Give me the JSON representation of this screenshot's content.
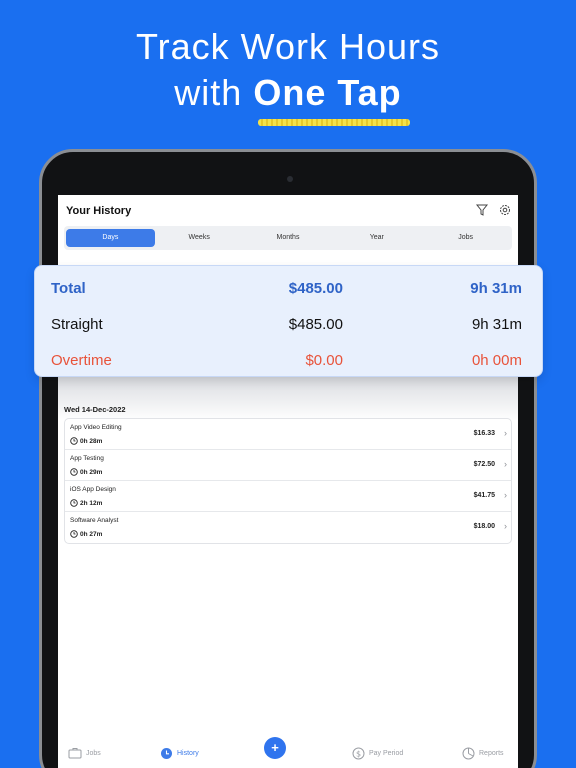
{
  "headline": {
    "line1": "Track Work Hours",
    "line2_prefix": "with ",
    "line2_bold": "One Tap"
  },
  "header": {
    "title": "Your History",
    "icons": [
      "filter-icon",
      "gear-icon"
    ]
  },
  "tabs": [
    {
      "label": "Days",
      "active": true
    },
    {
      "label": "Weeks",
      "active": false
    },
    {
      "label": "Months",
      "active": false
    },
    {
      "label": "Year",
      "active": false
    },
    {
      "label": "Jobs",
      "active": false
    }
  ],
  "summary": {
    "total": {
      "label": "Total",
      "amount": "$485.00",
      "time": "9h 31m"
    },
    "straight": {
      "label": "Straight",
      "amount": "$485.00",
      "time": "9h 31m"
    },
    "overtime": {
      "label": "Overtime",
      "amount": "$0.00",
      "time": "0h 00m"
    }
  },
  "day": {
    "date": "Wed 14-Dec-2022",
    "entries": [
      {
        "job": "App Video Editing",
        "duration": "0h 28m",
        "amount": "$16.33"
      },
      {
        "job": "App Testing",
        "duration": "0h 29m",
        "amount": "$72.50"
      },
      {
        "job": "iOS App Design",
        "duration": "2h 12m",
        "amount": "$41.75"
      },
      {
        "job": "Software Analyst",
        "duration": "0h 27m",
        "amount": "$18.00"
      }
    ]
  },
  "tabbar": {
    "jobs": "Jobs",
    "history": "History",
    "add": "+",
    "pay_period": "Pay Period",
    "reports": "Reports"
  },
  "colors": {
    "background": "#1a6ff0",
    "accent": "#3d7be8",
    "overtime": "#e8533a"
  }
}
